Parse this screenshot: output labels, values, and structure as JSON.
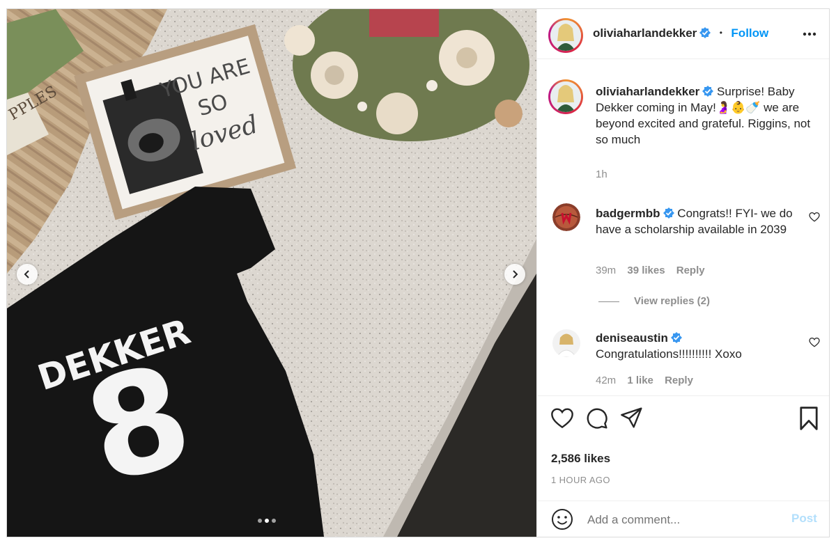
{
  "post": {
    "username": "olivia harlandekker",
    "handle": "oliviaharlandekker",
    "follow_label": "Follow",
    "separator": "•",
    "caption": "Surprise! Baby Dekker coming in May!🤰👶🍼 we are beyond excited and grateful. Riggins, not so much",
    "caption_time": "1h"
  },
  "photo": {
    "sign_text": [
      "YOU ARE",
      "SO",
      "loved"
    ],
    "shirt_name": "DEKKER",
    "shirt_number": "8",
    "carousel_dots": 3,
    "active_dot": 1
  },
  "comments": [
    {
      "username": "badgermbb",
      "text": "Congrats!! FYI- we do have a scholarship available in 2039",
      "time": "39m",
      "likes": "39 likes",
      "reply_label": "Reply",
      "view_replies": "View replies (2)"
    },
    {
      "username": "deniseaustin",
      "text": "Congratulations!!!!!!!!!! Xoxo",
      "time": "42m",
      "likes": "1 like",
      "reply_label": "Reply"
    }
  ],
  "stats": {
    "likes": "2,586 likes",
    "time_ago": "1 HOUR AGO"
  },
  "add_comment": {
    "placeholder": "Add a comment...",
    "post_label": "Post"
  },
  "icons": {
    "verified": "verified-badge-icon",
    "more": "more-options-icon",
    "heart": "heart-icon",
    "comment": "comment-icon",
    "share": "share-icon",
    "save": "bookmark-icon",
    "emoji": "emoji-icon",
    "prev": "chevron-left-icon",
    "next": "chevron-right-icon"
  },
  "colors": {
    "accent": "#0095f6",
    "text": "#262626",
    "muted": "#8e8e8e",
    "verified": "#3897f0",
    "post_disabled": "#b2dffc"
  }
}
